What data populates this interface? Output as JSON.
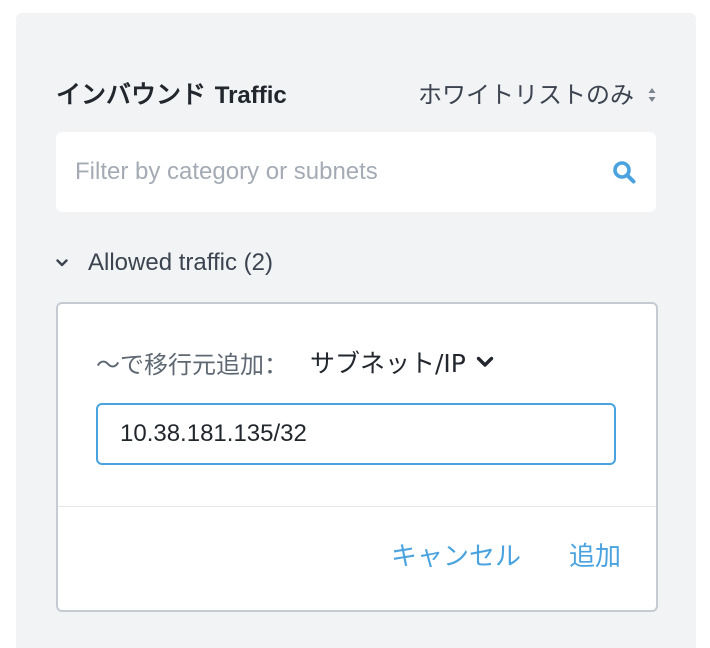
{
  "header": {
    "title_ja": "インバウンド",
    "title_en": "Traffic",
    "mode_label": "ホワイトリストのみ"
  },
  "search": {
    "placeholder": "Filter by category or subnets",
    "value": ""
  },
  "section": {
    "label": "Allowed traffic (2)",
    "expanded": true
  },
  "add_form": {
    "prefix": "〜で移行元追加：",
    "type_label": "サブネット/IP",
    "ip_value": "10.38.181.135/32",
    "cancel_label": "キャンセル",
    "add_label": "追加"
  },
  "colors": {
    "panel_bg": "#f2f3f5",
    "accent": "#4aa3df",
    "text_primary": "#22272e",
    "text_secondary": "#3b4450",
    "placeholder": "#a4abb5",
    "card_border": "#c6cbd3"
  },
  "icons": {
    "sort": "sort-updown-icon",
    "search": "search-icon",
    "section_toggle": "chevron-down-icon",
    "type_dropdown": "caret-down-icon"
  }
}
